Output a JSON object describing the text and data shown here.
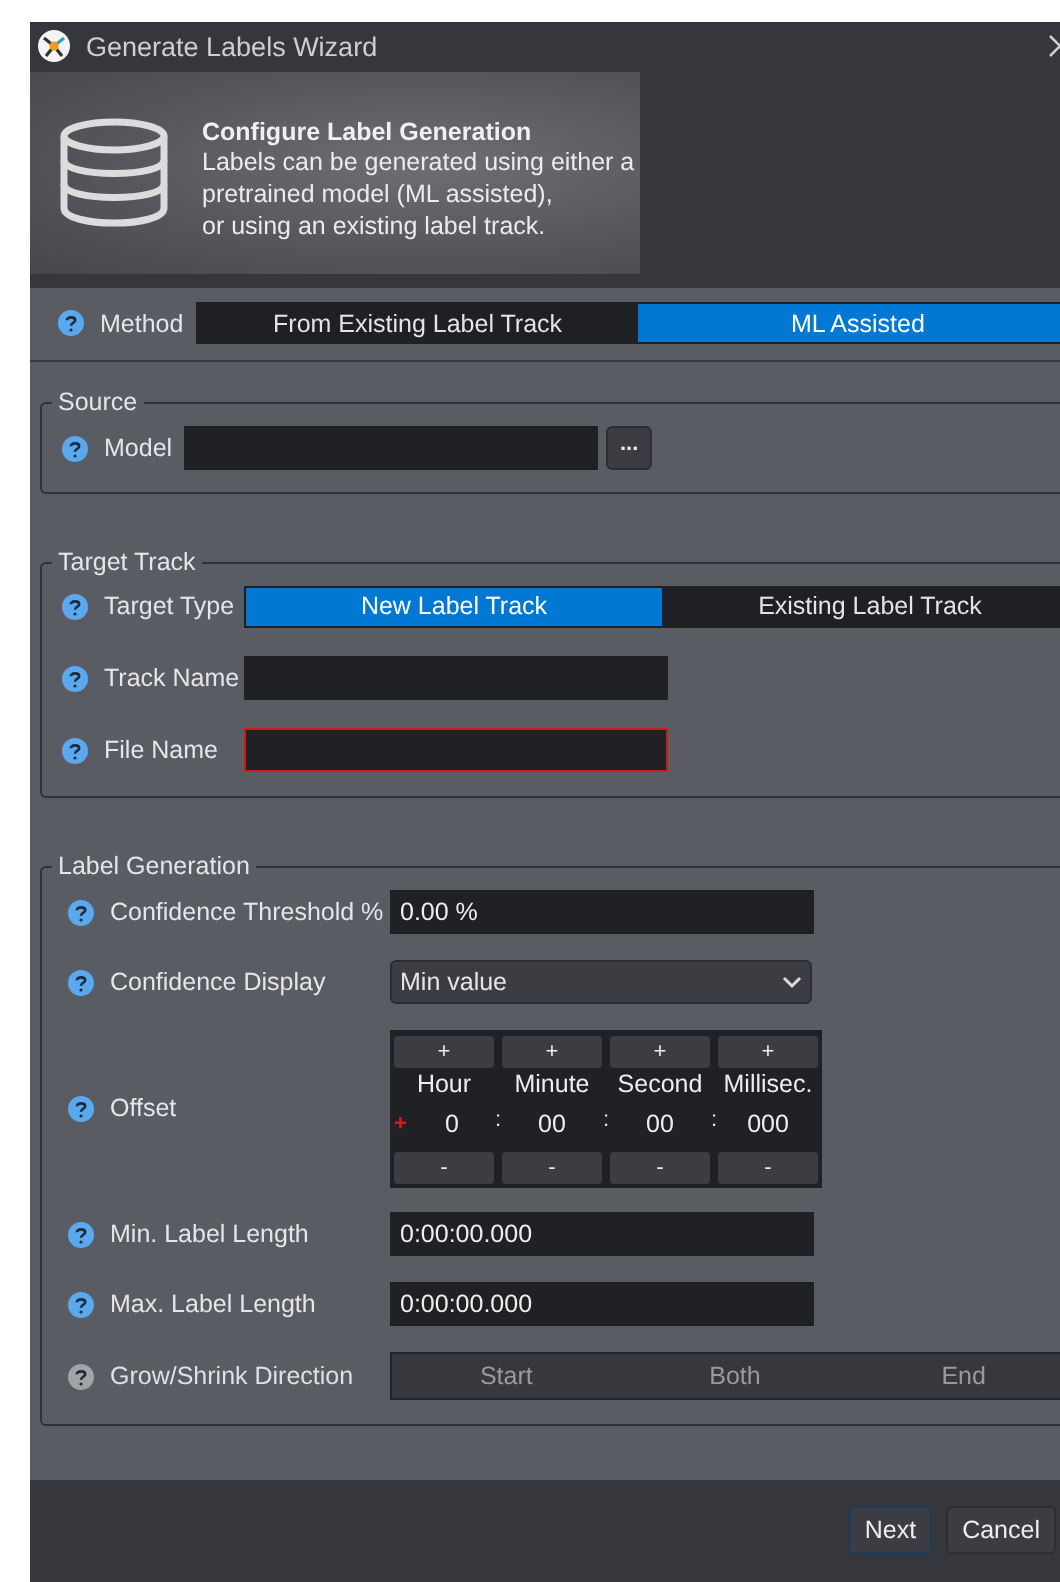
{
  "window": {
    "title": "Generate Labels Wizard"
  },
  "header": {
    "title": "Configure Label Generation",
    "lines": [
      "Labels can be generated using either a",
      "pretrained model (ML assisted),",
      "or using an existing label track."
    ]
  },
  "method": {
    "label": "Method",
    "options": [
      {
        "label": "From Existing Label Track",
        "selected": false
      },
      {
        "label": "ML Assisted",
        "selected": true
      }
    ]
  },
  "source": {
    "title": "Source",
    "model": {
      "label": "Model",
      "browse": "..."
    }
  },
  "target_track": {
    "title": "Target Track",
    "target_type": {
      "label": "Target Type",
      "options": [
        {
          "label": "New Label Track",
          "selected": true
        },
        {
          "label": "Existing Label Track",
          "selected": false
        }
      ]
    },
    "track_name": {
      "label": "Track Name",
      "invalid": false
    },
    "file_name": {
      "label": "File Name",
      "invalid": true
    }
  },
  "label_generation": {
    "title": "Label Generation",
    "rows": [
      {
        "kind": "text",
        "label": "Confidence Threshold %",
        "value": "0.00 %"
      },
      {
        "kind": "dropdown",
        "label": "Confidence Display",
        "value": "Min value"
      },
      {
        "kind": "offset",
        "label": "Offset",
        "sign": "+",
        "units": [
          {
            "name": "Hour",
            "value": "0",
            "increment": "+",
            "decrement": "-",
            "separator": ":"
          },
          {
            "name": "Minute",
            "value": "00",
            "increment": "+",
            "decrement": "-",
            "separator": ":"
          },
          {
            "name": "Second",
            "value": "00",
            "increment": "+",
            "decrement": "-",
            "separator": ":"
          },
          {
            "name": "Millisec.",
            "value": "000",
            "increment": "+",
            "decrement": "-"
          }
        ]
      },
      {
        "kind": "text",
        "label": "Min. Label Length",
        "value": "0:00:00.000"
      },
      {
        "kind": "text",
        "label": "Max. Label Length",
        "value": "0:00:00.000"
      },
      {
        "kind": "segments",
        "label": "Grow/Shrink Direction",
        "disabled": true,
        "options": [
          {
            "label": "Start",
            "selected": false
          },
          {
            "label": "Both",
            "selected": false
          },
          {
            "label": "End",
            "selected": false
          }
        ]
      }
    ]
  },
  "buttons": [
    {
      "label": "Next",
      "default": true
    },
    {
      "label": "Cancel",
      "default": false
    }
  ]
}
